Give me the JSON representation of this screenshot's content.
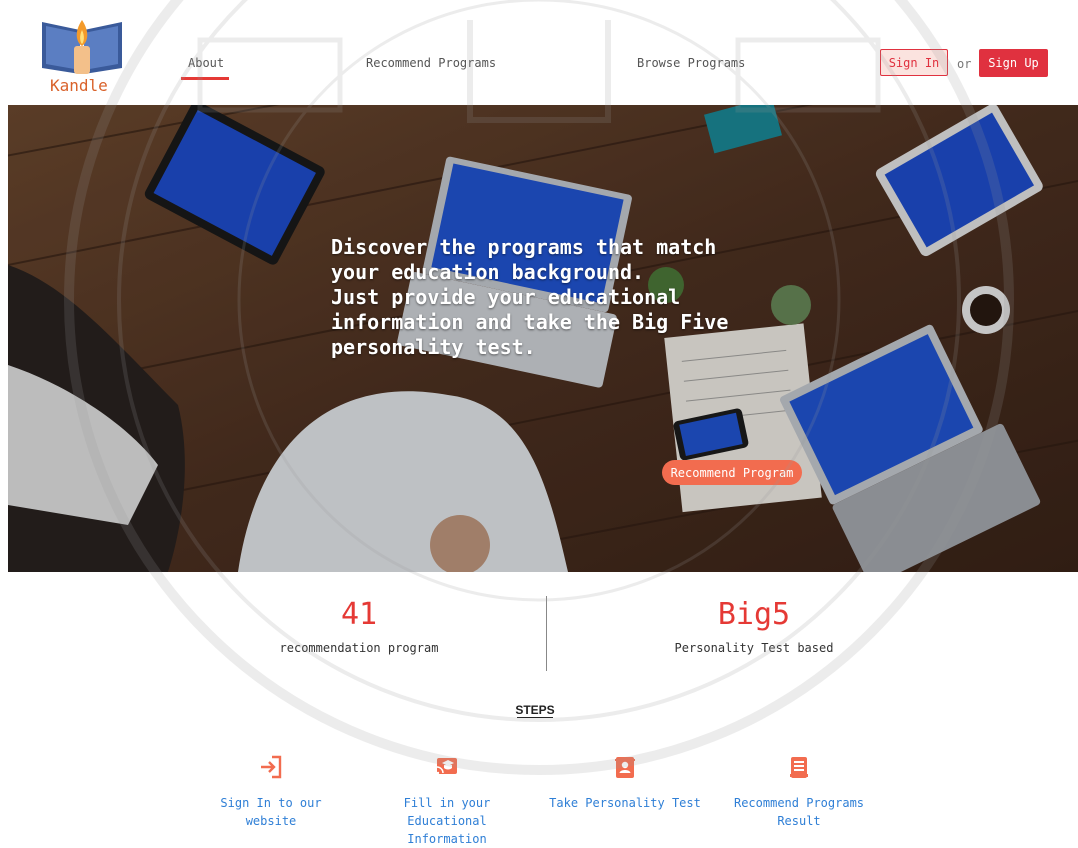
{
  "logo": {
    "text": "Kandle",
    "icon": "book-candle-logo"
  },
  "nav": {
    "about": "About",
    "recommend_programs": "Recommend Programs",
    "browse_programs": "Browse Programs"
  },
  "auth": {
    "sign_in": "Sign In",
    "or": "or",
    "sign_up": "Sign Up"
  },
  "hero": {
    "lines": [
      "Discover the programs that match",
      "your education background.",
      "Just provide your educational",
      "information and take the Big Five",
      "personality test."
    ],
    "button": "Recommend Program"
  },
  "stats": [
    {
      "value": "41",
      "label": "recommendation program"
    },
    {
      "value": "Big5",
      "label": "Personality Test based"
    }
  ],
  "steps": {
    "title": "STEPS",
    "items": [
      {
        "icon": "sign-in-icon",
        "lines": [
          "Sign In to our",
          "website"
        ]
      },
      {
        "icon": "education-screen-icon",
        "lines": [
          "Fill in your",
          "Educational",
          "Information"
        ]
      },
      {
        "icon": "contact-book-icon",
        "lines": [
          "Take Personality Test"
        ]
      },
      {
        "icon": "document-list-icon",
        "lines": [
          "Recommend Programs",
          "Result"
        ]
      }
    ]
  },
  "colors": {
    "accent": "#e53935",
    "signup_bg": "#e0313f",
    "hero_button": "#f26c4f",
    "step_text": "#2f7fd6",
    "step_icon": "#f26c4f"
  }
}
